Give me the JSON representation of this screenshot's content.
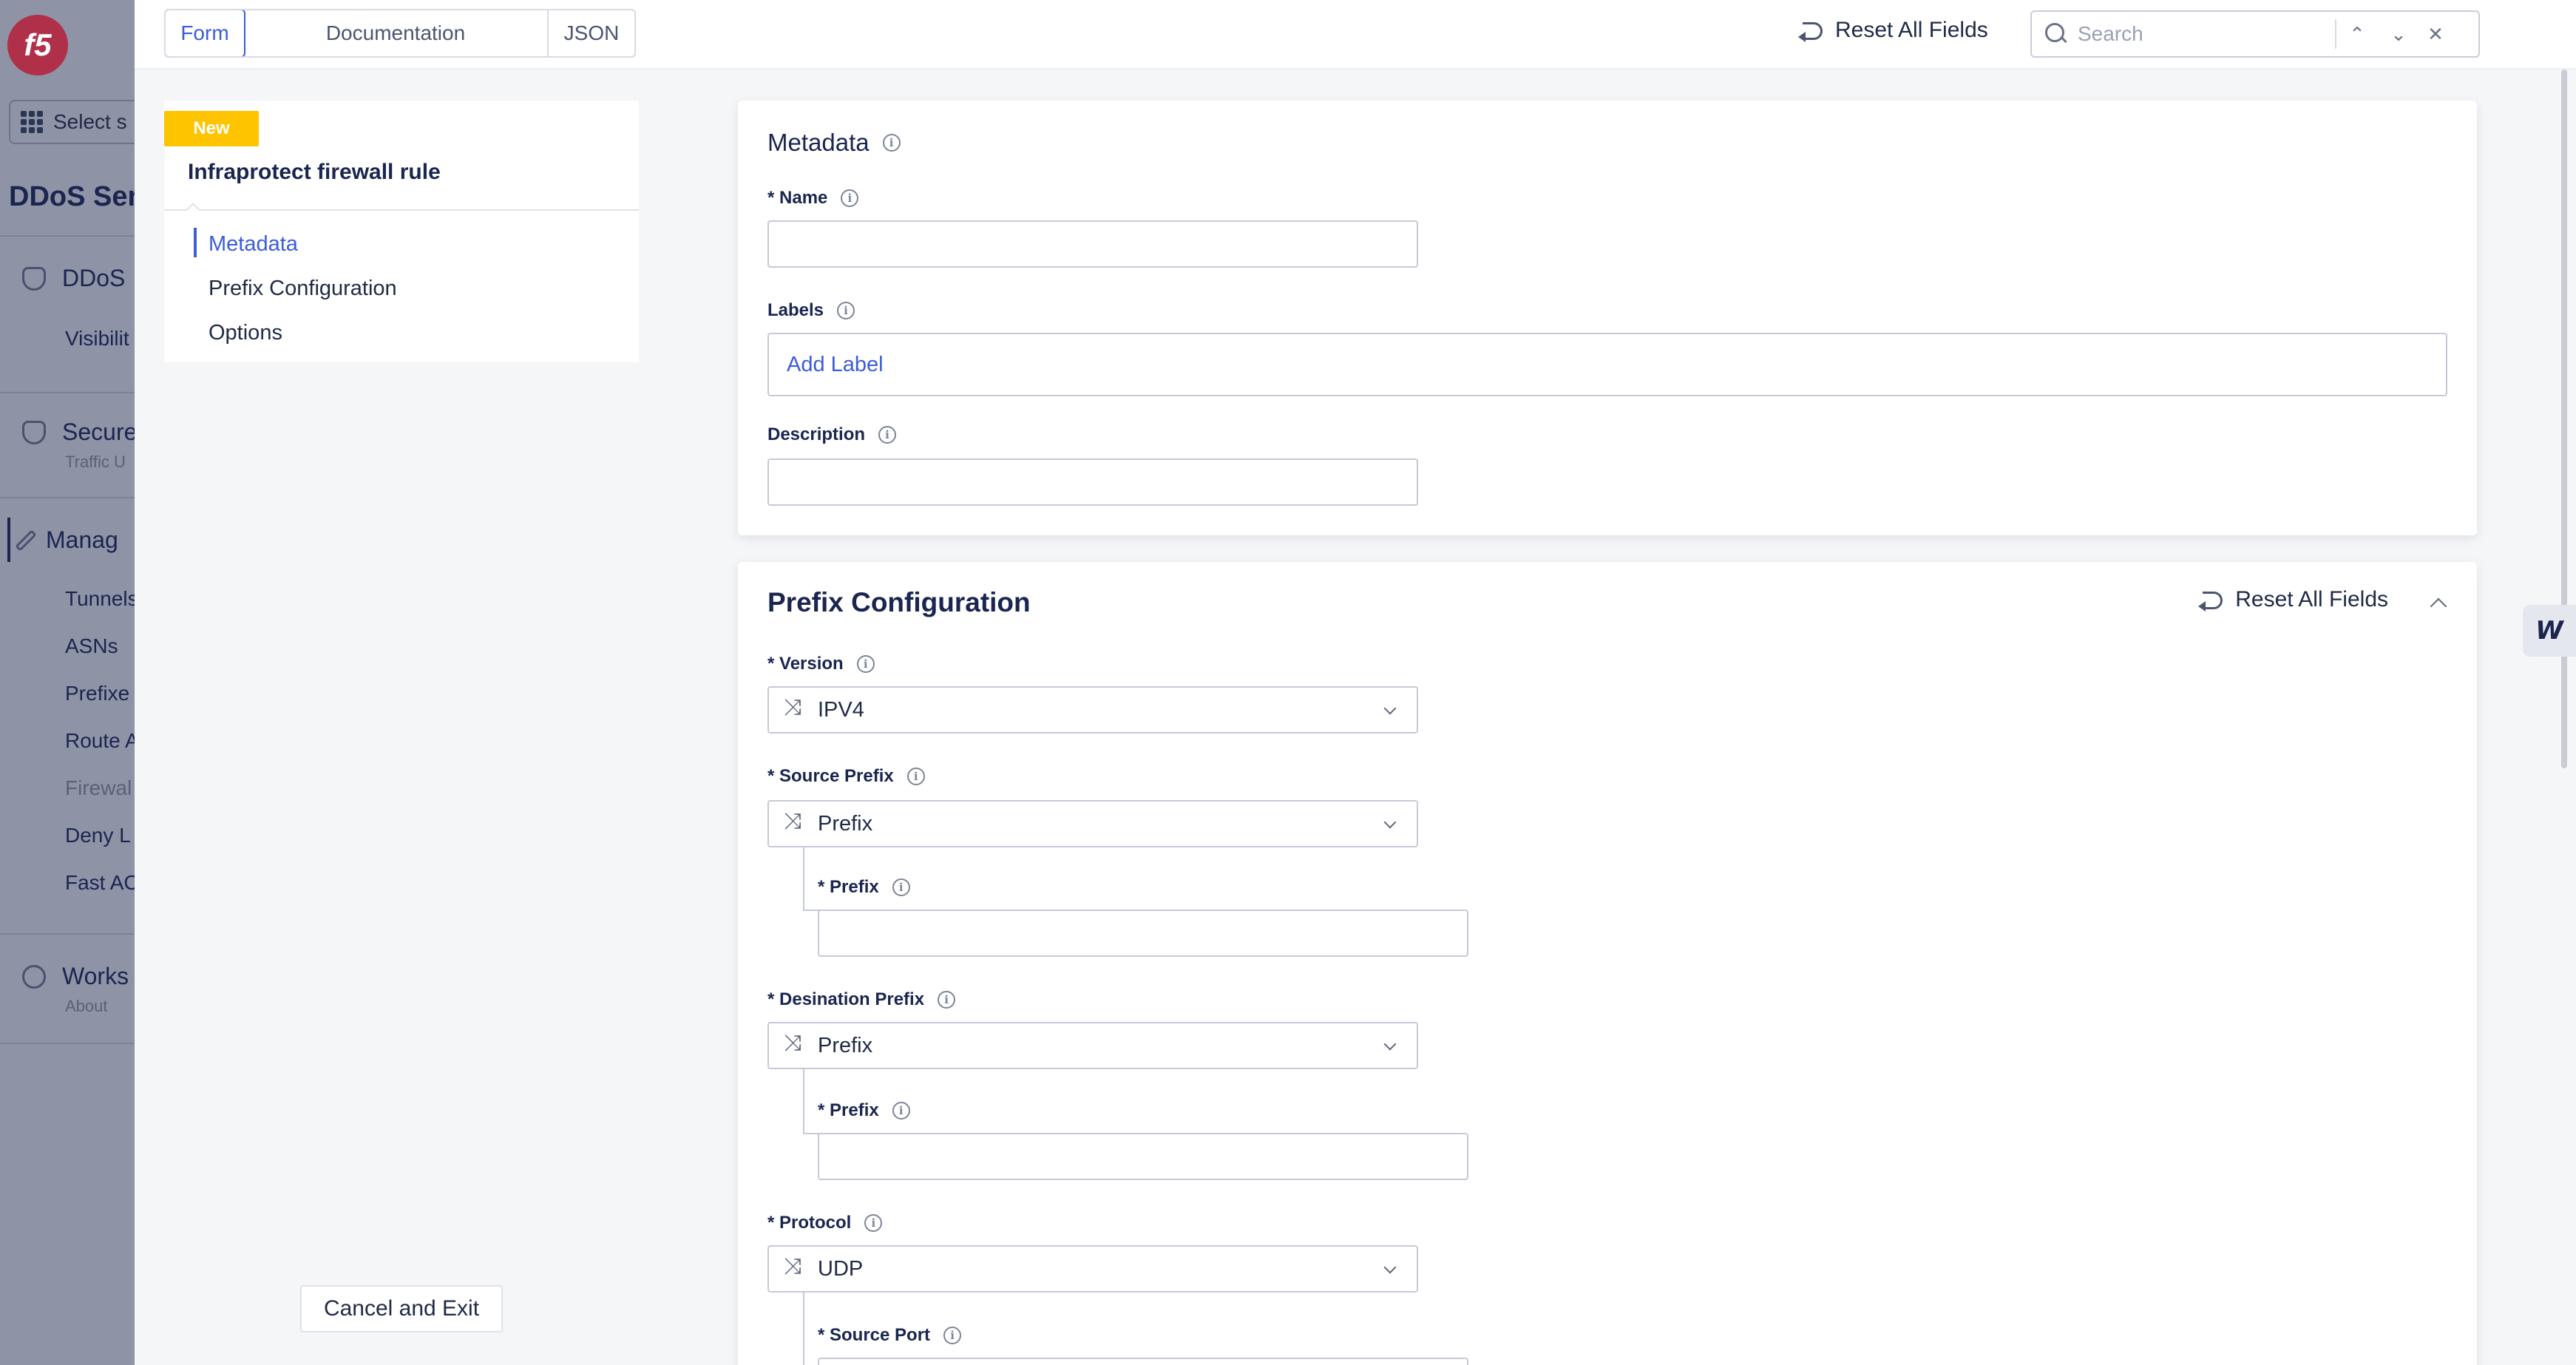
{
  "background_nav": {
    "logo": "f5",
    "select_service": "Select s",
    "service_title": "DDoS Serv",
    "group_ddos": "DDoS",
    "visibility": "Visibilit",
    "group_secure": "Secure",
    "secure_sub": "Traffic U",
    "group_manage": "Manag",
    "items": [
      "Tunnels",
      "ASNs",
      "Prefixe",
      "Route A",
      "Firewal",
      "Deny L",
      "Fast AC"
    ],
    "group_workspace": "Works",
    "workspace_sub": "About"
  },
  "topbar": {
    "tabs": [
      "Form",
      "Documentation",
      "JSON"
    ],
    "active_tab": "Form",
    "reset_all": "Reset All Fields",
    "search_placeholder": "Search",
    "search_prev": "⌃",
    "search_next": "⌄",
    "search_close": "✕"
  },
  "left_panel": {
    "badge": "New",
    "title": "Infraprotect firewall rule",
    "sections": [
      "Metadata",
      "Prefix Configuration",
      "Options"
    ],
    "active_section": "Metadata",
    "cancel": "Cancel and Exit"
  },
  "metadata": {
    "heading": "Metadata",
    "name_label": "* Name",
    "name_value": "",
    "labels_label": "Labels",
    "add_label": "Add Label",
    "description_label": "Description",
    "description_value": ""
  },
  "prefix_config": {
    "heading": "Prefix Configuration",
    "reset_all": "Reset All Fields",
    "version_label": "* Version",
    "version_value": "IPV4",
    "source_prefix_label": "* Source Prefix",
    "source_prefix_value": "Prefix",
    "source_prefix_sub_label": "* Prefix",
    "destination_prefix_label": "* Desination Prefix",
    "destination_prefix_value": "Prefix",
    "destination_prefix_sub_label": "* Prefix",
    "protocol_label": "* Protocol",
    "protocol_value": "UDP",
    "source_port_label": "* Source Port"
  },
  "widget": "W"
}
